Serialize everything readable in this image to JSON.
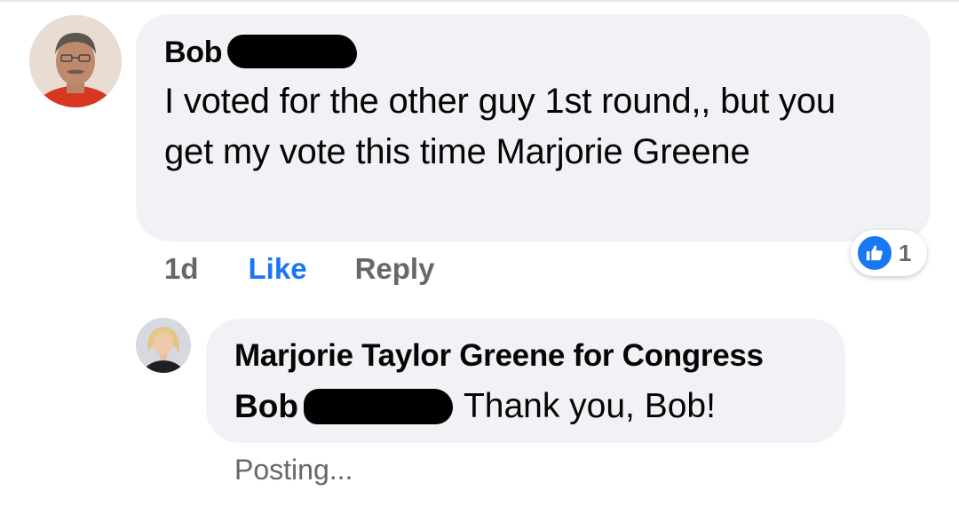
{
  "comment": {
    "author_first_name": "Bob",
    "text": "I voted for the other guy 1st round,, but you get my vote this time Marjorie Greene",
    "timestamp": "1d",
    "like_label": "Like",
    "reply_label": "Reply",
    "reaction": {
      "icon": "thumbs-up-icon",
      "count": "1",
      "color": "#1877f2"
    }
  },
  "reply": {
    "author": "Marjorie Taylor Greene for Congress",
    "mention_first_name": "Bob",
    "text": "Thank you, Bob!",
    "status": "Posting..."
  },
  "colors": {
    "bubble": "#f0f2f5",
    "link_blue": "#1877f2",
    "secondary_text": "#65676b",
    "redaction": "#000000"
  }
}
